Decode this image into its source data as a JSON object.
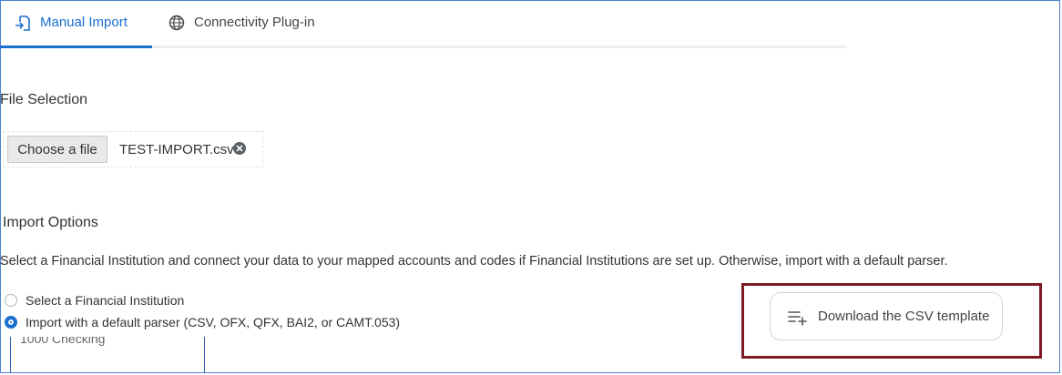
{
  "tabs": {
    "manual_import": {
      "label": "Manual Import",
      "icon": "import-file-icon"
    },
    "connectivity": {
      "label": "Connectivity Plug-in",
      "icon": "globe-icon"
    }
  },
  "file_selection": {
    "title": "File Selection",
    "choose_label": "Choose a file",
    "file_name": "TEST-IMPORT.csv"
  },
  "import_options": {
    "title": "Import Options",
    "description": "Select a Financial Institution and connect your data to your mapped accounts and codes if Financial Institutions are set up. Otherwise, import with a default parser.",
    "radios": [
      {
        "label": "Select a Financial Institution",
        "selected": false
      },
      {
        "label": "Import with a default parser (CSV, OFX, QFX, BAI2, or CAMT.053)",
        "selected": true
      }
    ],
    "account_dropdown_partial": "1000 Checking",
    "download_label": "Download the CSV template"
  },
  "colors": {
    "accent": "#1a6fd1",
    "highlight_border": "#7d1c24"
  }
}
